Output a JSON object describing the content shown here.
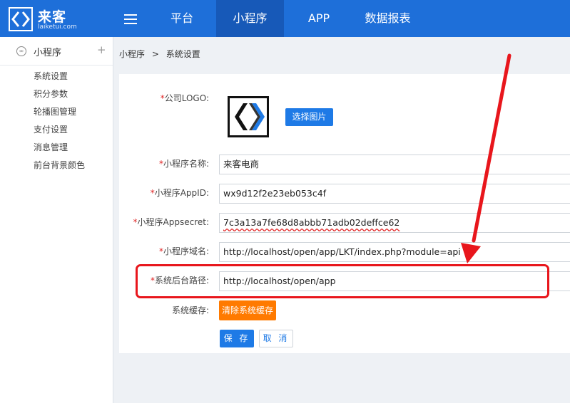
{
  "brand": {
    "name": "来客",
    "sub": "laiketui.com"
  },
  "nav": {
    "items": [
      {
        "label": "平台",
        "active": false
      },
      {
        "label": "小程序",
        "active": true
      },
      {
        "label": "APP",
        "active": false
      },
      {
        "label": "数据报表",
        "active": false
      }
    ]
  },
  "sidebar": {
    "title": "小程序",
    "plus": "+",
    "items": [
      "系统设置",
      "积分参数",
      "轮播图管理",
      "支付设置",
      "消息管理",
      "前台背景颜色"
    ]
  },
  "breadcrumb": {
    "parent": "小程序",
    "sep": ">",
    "current": "系统设置"
  },
  "form": {
    "required_mark": "*",
    "logo_label": "公司LOGO:",
    "choose_image": "选择图片",
    "name_label": "小程序名称:",
    "name_value": "来客电商",
    "appid_label": "小程序AppID:",
    "appid_value": "wx9d12f2e23eb053c4f",
    "secret_label": "小程序Appsecret:",
    "secret_value": "7c3a13a7fe68d8abbb71adb02deffce62",
    "domain_label": "小程序域名:",
    "domain_value": "http://localhost/open/app/LKT/index.php?module=api",
    "backend_label": "系统后台路径:",
    "backend_value": "http://localhost/open/app",
    "cache_label": "系统缓存:",
    "clear_cache": "清除系统缓存",
    "save": "保 存",
    "cancel": "取 消"
  },
  "colors": {
    "topbar": "#1e6fd9",
    "active_nav": "#1759b8",
    "primary": "#1e7ae6",
    "orange": "#ff7a00",
    "annotation": "#e8161c"
  }
}
